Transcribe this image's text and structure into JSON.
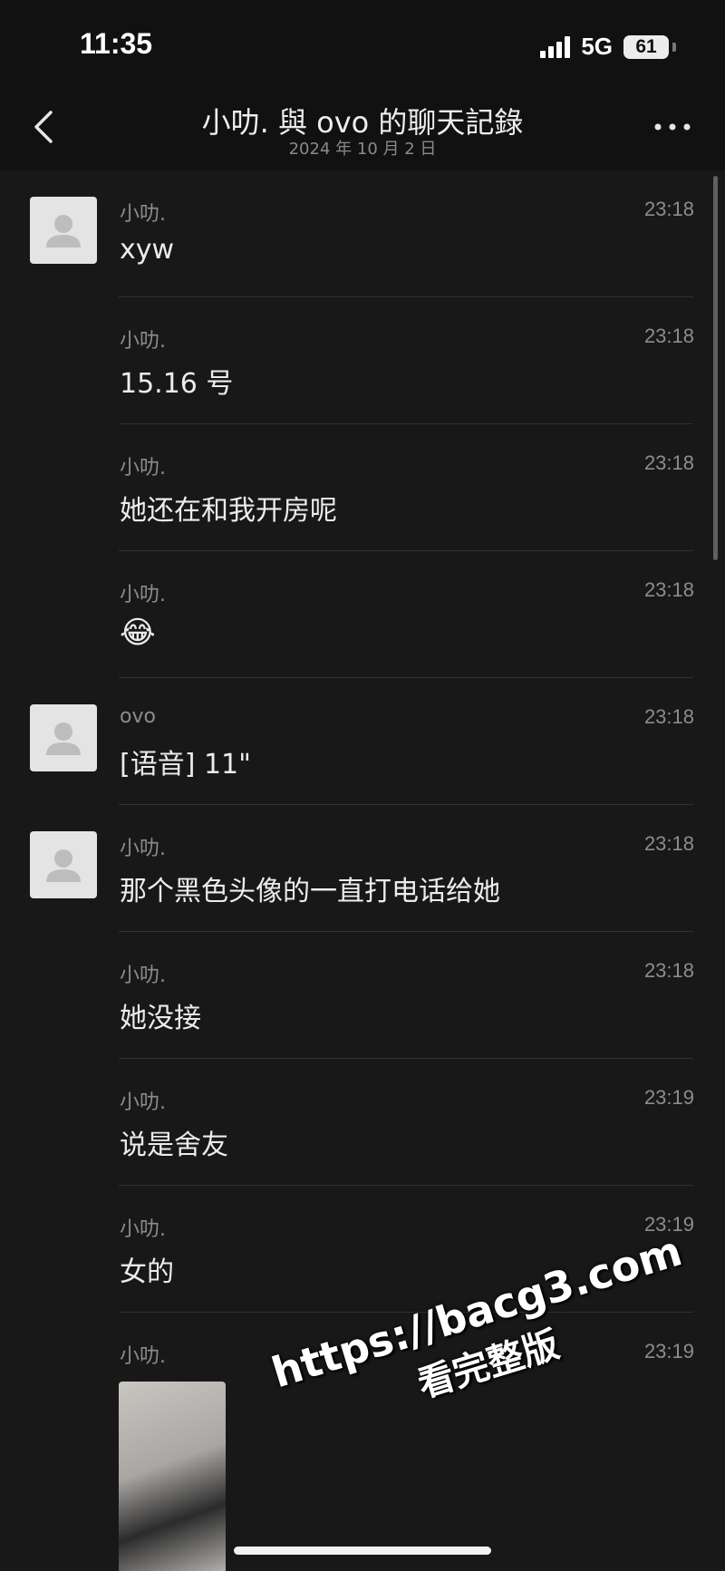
{
  "status_bar": {
    "time": "11:35",
    "network": "5G",
    "battery": "61"
  },
  "nav": {
    "title": "小叻. 與 ovo 的聊天記錄",
    "subtitle": "2024 年 10 月 2 日"
  },
  "messages": [
    {
      "sender": "小叻.",
      "time": "23:18",
      "text": "xyw"
    },
    {
      "sender": "小叻.",
      "time": "23:18",
      "text": "15.16 号"
    },
    {
      "sender": "小叻.",
      "time": "23:18",
      "text": "她还在和我开房呢"
    },
    {
      "sender": "小叻.",
      "time": "23:18",
      "text": "😂"
    },
    {
      "sender": "ovo",
      "time": "23:18",
      "text": "[语音] 11\""
    },
    {
      "sender": "小叻.",
      "time": "23:18",
      "text": "那个黑色头像的一直打电话给她"
    },
    {
      "sender": "小叻.",
      "time": "23:18",
      "text": "她没接"
    },
    {
      "sender": "小叻.",
      "time": "23:19",
      "text": "说是舍友"
    },
    {
      "sender": "小叻.",
      "time": "23:19",
      "text": "女的"
    },
    {
      "sender": "小叻.",
      "time": "23:19",
      "text": ""
    }
  ],
  "watermark": {
    "line1": "https://bacg3.com",
    "line2": "看完整版"
  }
}
